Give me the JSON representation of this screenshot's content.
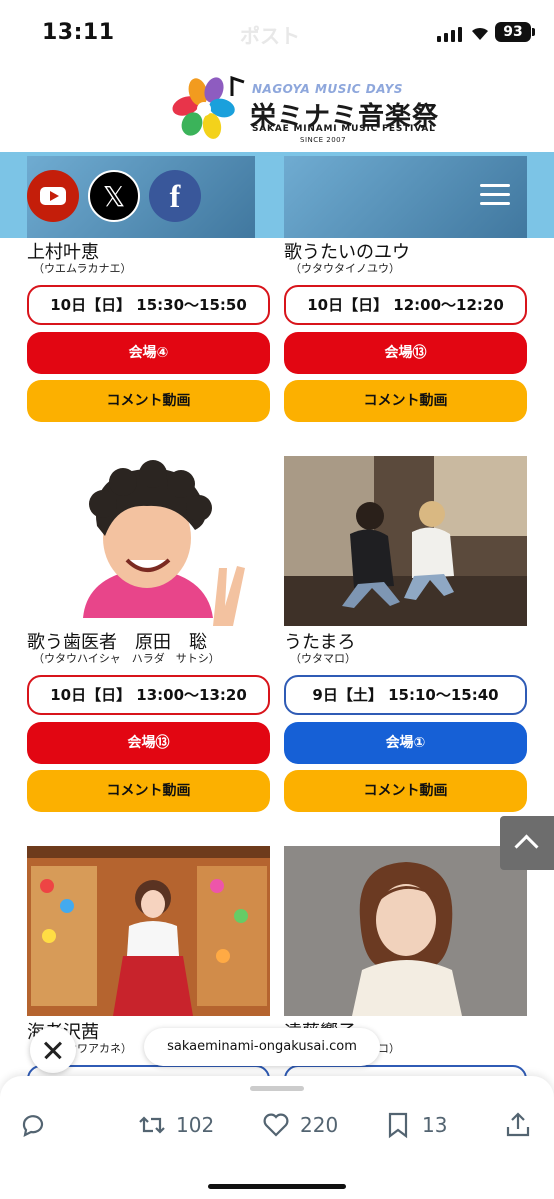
{
  "status_bar": {
    "time": "13:11",
    "battery": "93",
    "faded_title": "ポスト"
  },
  "site_logo": {
    "top_text": "NAGOYA MUSIC DAYS",
    "main_text": "栄ミナミ音楽祭",
    "sub_text": "SAKAE MINAMI MUSIC FESTIVAL",
    "since_text": "SINCE 2007"
  },
  "social": {
    "youtube": "youtube-icon",
    "x": "𝕏",
    "facebook": "f"
  },
  "cards": [
    {
      "name": "上村叶恵",
      "kana": "（ウエムラカナエ）",
      "time": "10日【日】 15:30〜15:50",
      "venue": "会場④",
      "venue_color": "#e20612",
      "comment": "コメント動画"
    },
    {
      "name": "歌うたいのユウ",
      "kana": "（ウタウタイノユウ）",
      "time": "10日【日】 12:00〜12:20",
      "venue": "会場⑬",
      "venue_color": "#e20612",
      "comment": "コメント動画"
    },
    {
      "name": "歌う歯医者　原田　聡",
      "kana": "（ウタウハイシャ　ハラダ　サトシ）",
      "time": "10日【日】 13:00〜13:20",
      "venue": "会場⑬",
      "venue_color": "#e20612",
      "comment": "コメント動画"
    },
    {
      "name": "うたまろ",
      "kana": "（ウタマロ）",
      "time": "9日【土】 15:10〜15:40",
      "venue": "会場①",
      "venue_color": "#1660d6",
      "comment": "コメント動画"
    },
    {
      "name": "海老沢茜",
      "kana": "（エビサワアカネ）"
    },
    {
      "name": "遠藤響子",
      "kana": "（エンドウキョウコ）"
    }
  ],
  "browser": {
    "url": "sakaeminami-ongakusai.com"
  },
  "actions": {
    "replies": "",
    "reposts": "102",
    "likes": "220",
    "bookmarks": "13"
  }
}
